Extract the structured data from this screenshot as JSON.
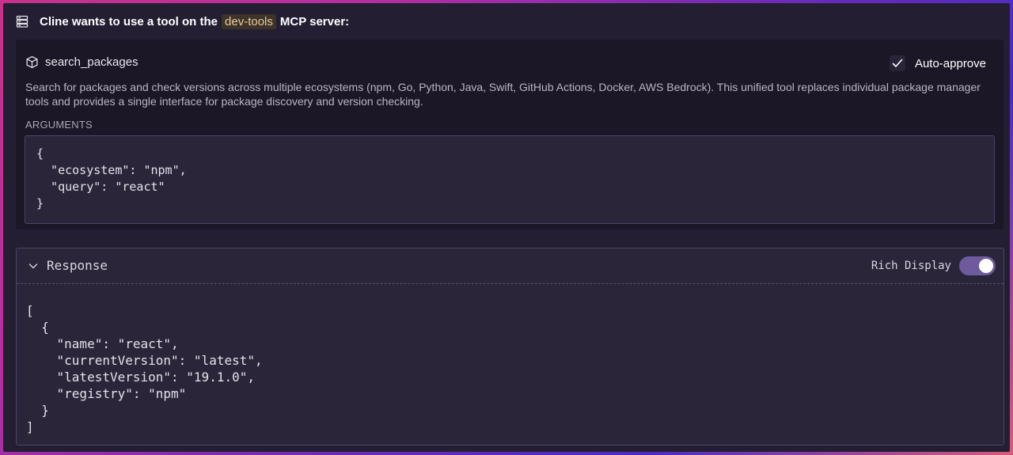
{
  "header": {
    "text_before": "Cline wants to use a tool on the",
    "server_name": "dev-tools",
    "text_after": "MCP server:",
    "icon": "server-icon"
  },
  "tool": {
    "name": "search_packages",
    "icon": "cube-icon",
    "auto_approve_label": "Auto-approve",
    "auto_approve_checked": true,
    "description": "Search for packages and check versions across multiple ecosystems (npm, Go, Python, Java, Swift, GitHub Actions, Docker, AWS Bedrock). This unified tool replaces individual package manager tools and provides a single interface for package discovery and version checking.",
    "arguments_label": "ARGUMENTS",
    "arguments_json": "{\n  \"ecosystem\": \"npm\",\n  \"query\": \"react\"\n}"
  },
  "response": {
    "title": "Response",
    "collapse_icon": "chevron-down-icon",
    "rich_display_label": "Rich Display",
    "rich_display_on": true,
    "body_json": "[\n  {\n    \"name\": \"react\",\n    \"currentVersion\": \"latest\",\n    \"latestVersion\": \"19.1.0\",\n    \"registry\": \"npm\"\n  }\n]"
  },
  "colors": {
    "panel_bg": "#241e33",
    "card_bg": "#1c1727",
    "code_bg": "#2a2539",
    "toggle_on": "#6e5a9c",
    "server_chip_bg": "#3d3428",
    "server_chip_text": "#e8c9a0"
  }
}
